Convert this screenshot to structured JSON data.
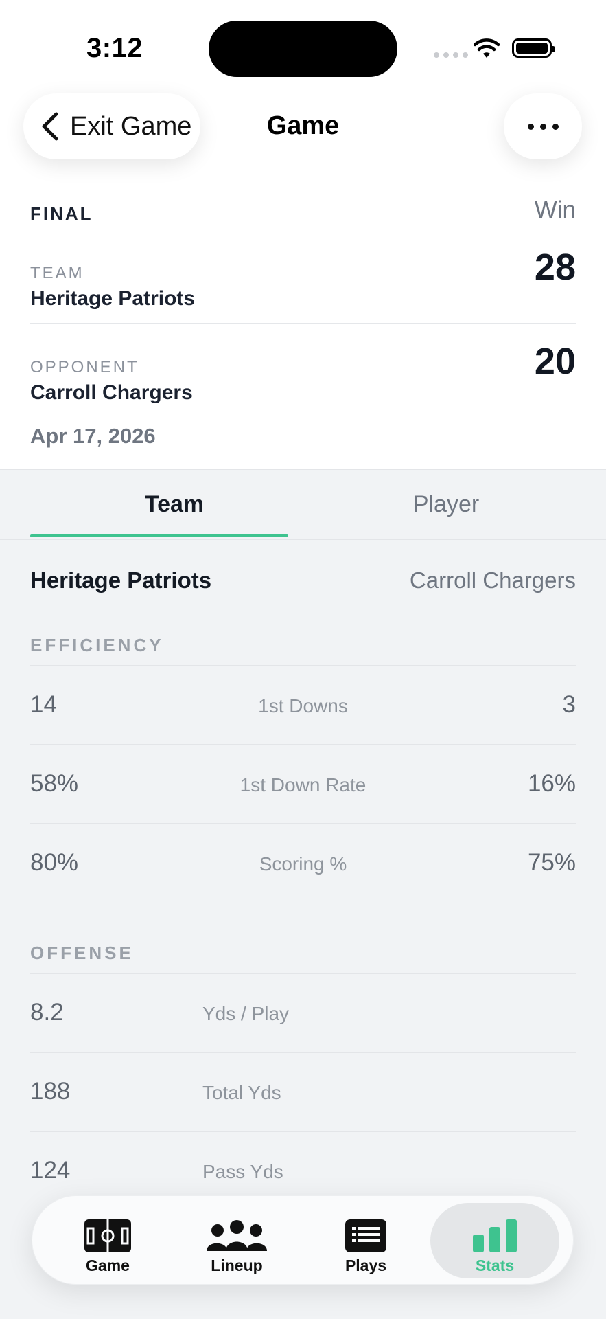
{
  "status_bar": {
    "time": "3:12"
  },
  "header": {
    "back_label": "Exit Game",
    "title": "Game"
  },
  "score": {
    "status": "FINAL",
    "result": "Win",
    "team_label": "TEAM",
    "team_name": "Heritage Patriots",
    "team_score": "28",
    "opponent_label": "OPPONENT",
    "opponent_name": "Carroll Chargers",
    "opponent_score": "20",
    "date": "Apr 17, 2026"
  },
  "segments": {
    "team": "Team",
    "player": "Player",
    "selected": "Team"
  },
  "comparison": {
    "home": "Heritage Patriots",
    "away": "Carroll Chargers"
  },
  "efficiency": {
    "title": "EFFICIENCY",
    "rows": [
      {
        "label": "1st Downs",
        "home": "14",
        "away": "3"
      },
      {
        "label": "1st Down Rate",
        "home": "58%",
        "away": "16%"
      },
      {
        "label": "Scoring %",
        "home": "80%",
        "away": "75%"
      }
    ]
  },
  "offense": {
    "title": "OFFENSE",
    "rows": [
      {
        "label": "Yds / Play",
        "home": "8.2"
      },
      {
        "label": "Total Yds",
        "home": "188"
      },
      {
        "label": "Pass Yds",
        "home": "124"
      }
    ]
  },
  "tabbar": {
    "items": [
      {
        "label": "Game",
        "icon": "field-icon"
      },
      {
        "label": "Lineup",
        "icon": "people-icon"
      },
      {
        "label": "Plays",
        "icon": "list-icon"
      },
      {
        "label": "Stats",
        "icon": "bar-chart-icon"
      }
    ],
    "active": "Stats",
    "active_color": "#3ec38f"
  }
}
